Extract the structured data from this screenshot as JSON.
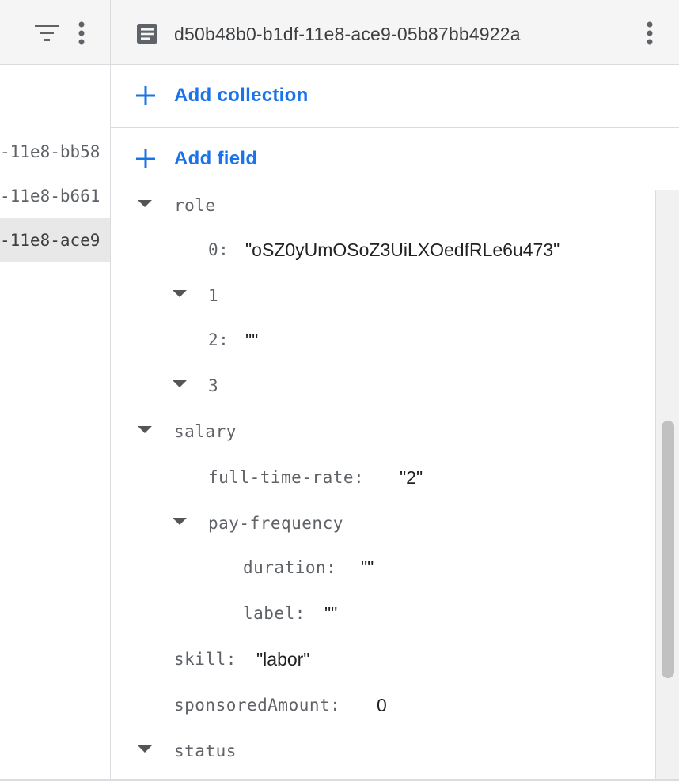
{
  "left_panel": {
    "documents": [
      {
        "label": "-11e8-bb58"
      },
      {
        "label": "-11e8-b661"
      },
      {
        "label": "-11e8-ace9"
      }
    ]
  },
  "document": {
    "id": "d50b48b0-b1df-11e8-ace9-05b87bb4922a"
  },
  "actions": {
    "add_collection": "Add collection",
    "add_field": "Add field"
  },
  "fields": {
    "role": {
      "key": "role",
      "item0": {
        "key": "0:",
        "value": "\"oSZ0yUmOSoZ3UiLXOedfRLe6u473\""
      },
      "item1": {
        "key": "1"
      },
      "item2": {
        "key": "2:",
        "value": "\"\""
      },
      "item3": {
        "key": "3"
      }
    },
    "salary": {
      "key": "salary",
      "full_time_rate": {
        "key": "full-time-rate:",
        "value": "\"2\""
      },
      "pay_frequency": {
        "key": "pay-frequency",
        "duration": {
          "key": "duration:",
          "value": "\"\""
        },
        "label": {
          "key": "label:",
          "value": "\"\""
        }
      }
    },
    "skill": {
      "key": "skill:",
      "value": "\"labor\""
    },
    "sponsoredAmount": {
      "key": "sponsoredAmount:",
      "value": "0"
    },
    "status": {
      "key": "status"
    }
  },
  "icons": {
    "filter": "filter-icon",
    "more": "more-vert-icon",
    "document": "document-icon",
    "add": "plus-icon",
    "expand": "caret-down-icon"
  },
  "colors": {
    "accent": "#1a73e8",
    "header_bg": "#f5f5f5",
    "selected_bg": "#e8e8e8"
  }
}
